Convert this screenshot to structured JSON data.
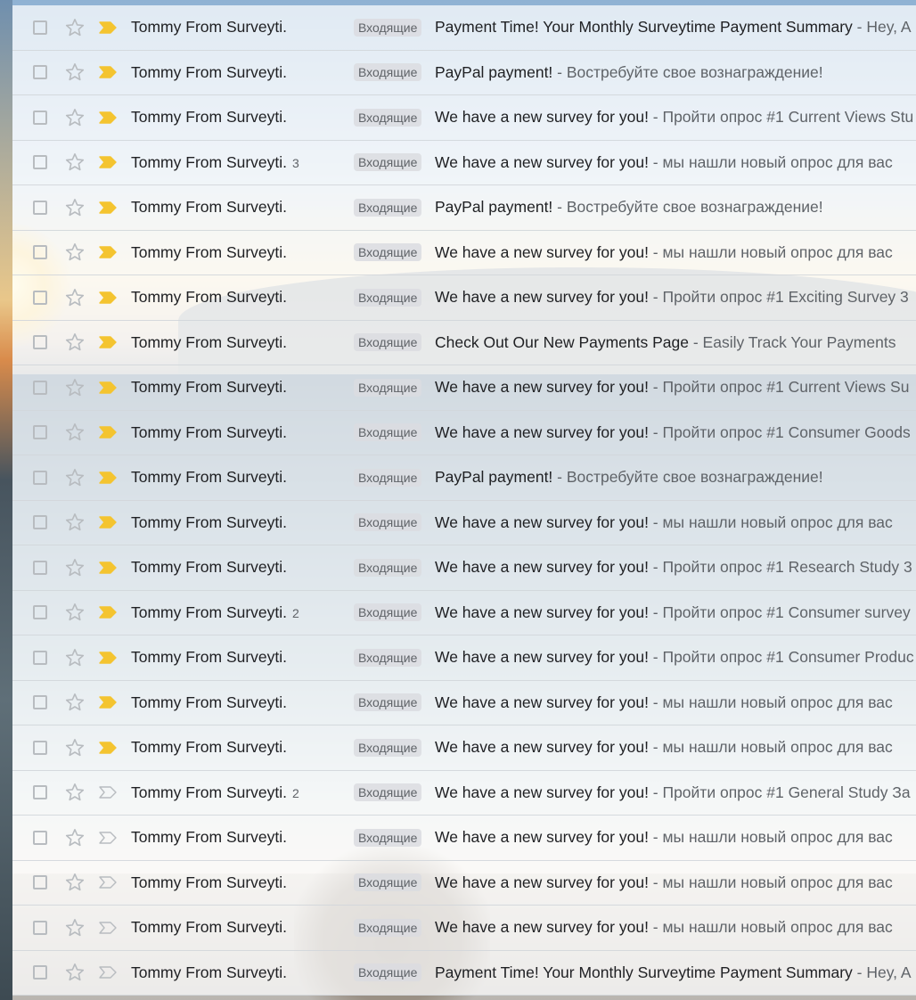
{
  "colors": {
    "important": "#f4c430",
    "important_outline": "#b8bcc0",
    "star_outline": "#b8bcc0"
  },
  "rows": [
    {
      "sender": "Tommy From Surveyti.",
      "count": "",
      "label": "Входящие",
      "subject": "Payment Time! Your Monthly Surveytime Payment Summary",
      "snippet": " - Hey, A",
      "important": true
    },
    {
      "sender": "Tommy From Surveyti.",
      "count": "",
      "label": "Входящие",
      "subject": "PayPal payment!",
      "snippet": " - Востребуйте свое вознаграждение!",
      "important": true
    },
    {
      "sender": "Tommy From Surveyti.",
      "count": "",
      "label": "Входящие",
      "subject": "We have a new survey for you!",
      "snippet": " - Пройти опрос #1 Current Views Stu",
      "important": true
    },
    {
      "sender": "Tommy From Surveyti.",
      "count": "3",
      "label": "Входящие",
      "subject": "We have a new survey for you!",
      "snippet": " - мы нашли новый опрос для вас",
      "important": true
    },
    {
      "sender": "Tommy From Surveyti.",
      "count": "",
      "label": "Входящие",
      "subject": "PayPal payment!",
      "snippet": " - Востребуйте свое вознаграждение!",
      "important": true
    },
    {
      "sender": "Tommy From Surveyti.",
      "count": "",
      "label": "Входящие",
      "subject": "We have a new survey for you!",
      "snippet": " - мы нашли новый опрос для вас",
      "important": true
    },
    {
      "sender": "Tommy From Surveyti.",
      "count": "",
      "label": "Входящие",
      "subject": "We have a new survey for you!",
      "snippet": " - Пройти опрос #1 Exciting Survey 3",
      "important": true
    },
    {
      "sender": "Tommy From Surveyti.",
      "count": "",
      "label": "Входящие",
      "subject": "Check Out Our New Payments Page",
      "snippet": " - Easily Track Your Payments",
      "important": true
    },
    {
      "sender": "Tommy From Surveyti.",
      "count": "",
      "label": "Входящие",
      "subject": "We have a new survey for you!",
      "snippet": " - Пройти опрос #1 Current Views Su",
      "important": true
    },
    {
      "sender": "Tommy From Surveyti.",
      "count": "",
      "label": "Входящие",
      "subject": "We have a new survey for you!",
      "snippet": " - Пройти опрос #1 Consumer Goods",
      "important": true
    },
    {
      "sender": "Tommy From Surveyti.",
      "count": "",
      "label": "Входящие",
      "subject": "PayPal payment!",
      "snippet": " - Востребуйте свое вознаграждение!",
      "important": true
    },
    {
      "sender": "Tommy From Surveyti.",
      "count": "",
      "label": "Входящие",
      "subject": "We have a new survey for you!",
      "snippet": " - мы нашли новый опрос для вас",
      "important": true
    },
    {
      "sender": "Tommy From Surveyti.",
      "count": "",
      "label": "Входящие",
      "subject": "We have a new survey for you!",
      "snippet": " - Пройти опрос #1 Research Study 3",
      "important": true
    },
    {
      "sender": "Tommy From Surveyti.",
      "count": "2",
      "label": "Входящие",
      "subject": "We have a new survey for you!",
      "snippet": " - Пройти опрос #1 Consumer survey",
      "important": true
    },
    {
      "sender": "Tommy From Surveyti.",
      "count": "",
      "label": "Входящие",
      "subject": "We have a new survey for you!",
      "snippet": " - Пройти опрос #1 Consumer Produc",
      "important": true
    },
    {
      "sender": "Tommy From Surveyti.",
      "count": "",
      "label": "Входящие",
      "subject": "We have a new survey for you!",
      "snippet": " - мы нашли новый опрос для вас",
      "important": true
    },
    {
      "sender": "Tommy From Surveyti.",
      "count": "",
      "label": "Входящие",
      "subject": "We have a new survey for you!",
      "snippet": " - мы нашли новый опрос для вас",
      "important": true
    },
    {
      "sender": "Tommy From Surveyti.",
      "count": "2",
      "label": "Входящие",
      "subject": "We have a new survey for you!",
      "snippet": " - Пройти опрос #1 General Study За",
      "important": false
    },
    {
      "sender": "Tommy From Surveyti.",
      "count": "",
      "label": "Входящие",
      "subject": "We have a new survey for you!",
      "snippet": " - мы нашли новый опрос для вас",
      "important": false
    },
    {
      "sender": "Tommy From Surveyti.",
      "count": "",
      "label": "Входящие",
      "subject": "We have a new survey for you!",
      "snippet": " - мы нашли новый опрос для вас",
      "important": false
    },
    {
      "sender": "Tommy From Surveyti.",
      "count": "",
      "label": "Входящие",
      "subject": "We have a new survey for you!",
      "snippet": " - мы нашли новый опрос для вас",
      "important": false
    },
    {
      "sender": "Tommy From Surveyti.",
      "count": "",
      "label": "Входящие",
      "subject": "Payment Time! Your Monthly Surveytime Payment Summary",
      "snippet": " - Hey, A",
      "important": false
    }
  ]
}
